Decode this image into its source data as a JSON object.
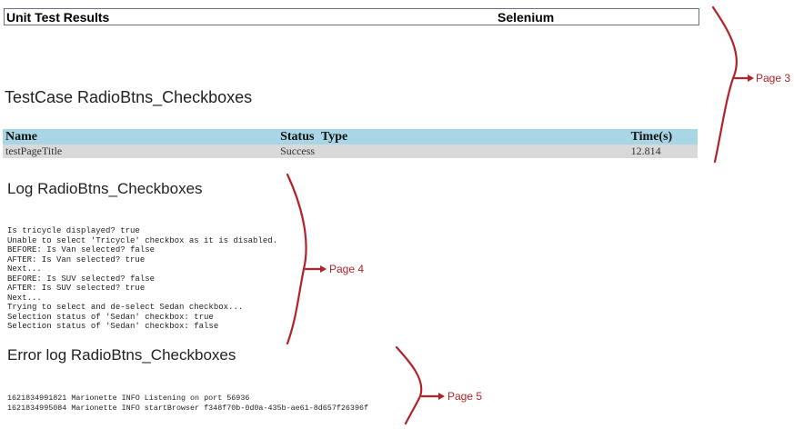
{
  "header": {
    "title": "Unit Test Results",
    "product": "Selenium"
  },
  "testcase": {
    "heading": "TestCase RadioBtns_Checkboxes",
    "columns": [
      "Name",
      "Status",
      "Type",
      "Time(s)"
    ],
    "rows": [
      {
        "name": "testPageTitle",
        "status": "Success",
        "type": "",
        "time": "12.814"
      }
    ]
  },
  "log": {
    "heading": "Log RadioBtns_Checkboxes",
    "lines": [
      "Is tricycle displayed? true",
      "Unable to select 'Tricycle' checkbox as it is disabled.",
      "BEFORE: Is Van selected? false",
      "AFTER: Is Van selected? true",
      "Next...",
      "BEFORE: Is SUV selected? false",
      "AFTER: Is SUV selected? true",
      "Next...",
      "Trying to select and de-select Sedan checkbox...",
      "Selection status of 'Sedan' checkbox: true",
      "Selection status of 'Sedan' checkbox: false"
    ]
  },
  "error_log": {
    "heading": "Error log RadioBtns_Checkboxes",
    "lines": [
      "1621834991821 Marionette INFO Listening on port 56936",
      "1621834995084 Marionette INFO startBrowser f348f70b-0d0a-435b-ae61-8d657f26396f"
    ]
  },
  "annotations": {
    "color": "#b0232a",
    "pages": [
      {
        "label": "Page 3"
      },
      {
        "label": "Page 4"
      },
      {
        "label": "Page 5"
      }
    ]
  }
}
